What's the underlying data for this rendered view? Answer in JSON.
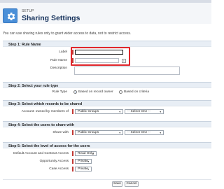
{
  "header": {
    "setup_label": "SETUP",
    "title": "Sharing Settings",
    "icon": "gear-icon"
  },
  "intro": "You can use sharing rules only to grant wider access to data, not to restrict access.",
  "step1": {
    "title": "Step 1: Rule Name",
    "label_label": "Label",
    "label_value": "",
    "rule_name_label": "Rule Name",
    "rule_name_value": "",
    "lookup_glyph": "i",
    "description_label": "Description",
    "description_value": ""
  },
  "step2": {
    "title": "Step 2: Select your rule type",
    "rule_type_label": "Rule Type",
    "option_owner": "Based on record owner",
    "option_criteria": "Based on criteria",
    "selected": "owner"
  },
  "step3": {
    "title": "Step 3: Select which records to be shared",
    "field_label": "Account: owned by members of",
    "group_select": "Public Groups",
    "member_select": "-- Select One --"
  },
  "step4": {
    "title": "Step 4: Select the users to share with",
    "field_label": "Share with",
    "group_select": "Public Groups",
    "member_select": "-- Select One --"
  },
  "step5": {
    "title": "Step 5: Select the level of access for the users",
    "rows": [
      {
        "label": "Default Account and Contract Access",
        "value": "Read Only"
      },
      {
        "label": "Opportunity Access",
        "value": "Private"
      },
      {
        "label": "Case Access",
        "value": "Private"
      }
    ]
  },
  "buttons": {
    "save": "Save",
    "cancel": "Cancel"
  },
  "colors": {
    "accent": "#4a8fd8",
    "required": "#c23934",
    "highlight": "#e0262b",
    "section_bg": "#e8eef5"
  }
}
